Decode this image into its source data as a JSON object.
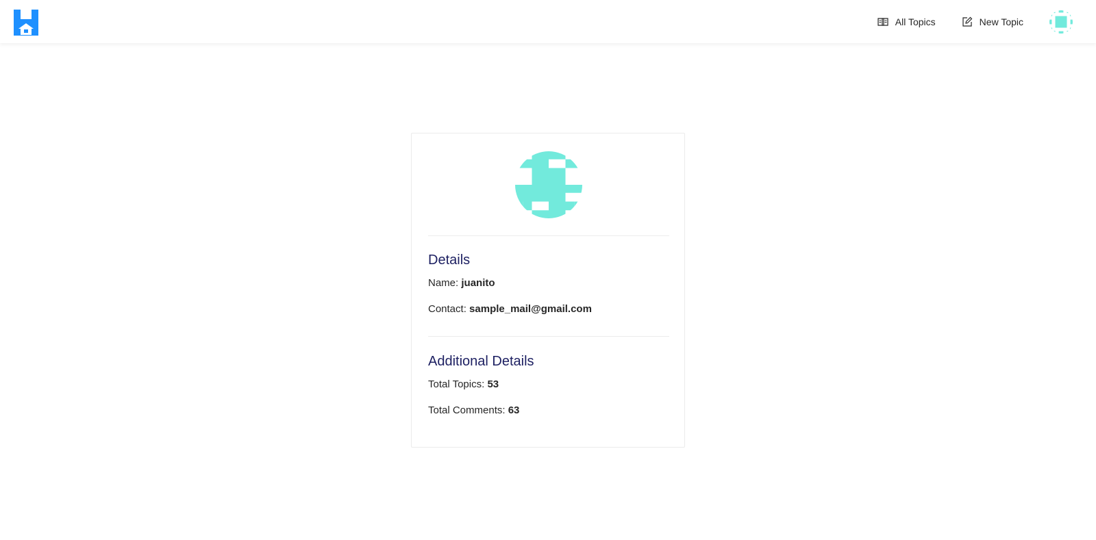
{
  "nav": {
    "logo_icon": "house-h-logo-icon",
    "links": [
      {
        "label": "All Topics",
        "icon": "book-icon"
      },
      {
        "label": "New Topic",
        "icon": "edit-icon"
      }
    ],
    "avatar_icon": "identicon-avatar-icon"
  },
  "profile": {
    "avatar_icon": "identicon-avatar-icon",
    "avatar_color": "#72EADC",
    "details": {
      "title": "Details",
      "name_label": "Name:",
      "name_value": "juanito",
      "contact_label": "Contact:",
      "contact_value": "sample_mail@gmail.com"
    },
    "additional": {
      "title": "Additional Details",
      "topics_label": "Total Topics:",
      "topics_value": "53",
      "comments_label": "Total Comments:",
      "comments_value": "63"
    }
  },
  "colors": {
    "brand_blue": "#1E90FF",
    "heading": "#1C1F61",
    "avatar": "#72EADC"
  }
}
